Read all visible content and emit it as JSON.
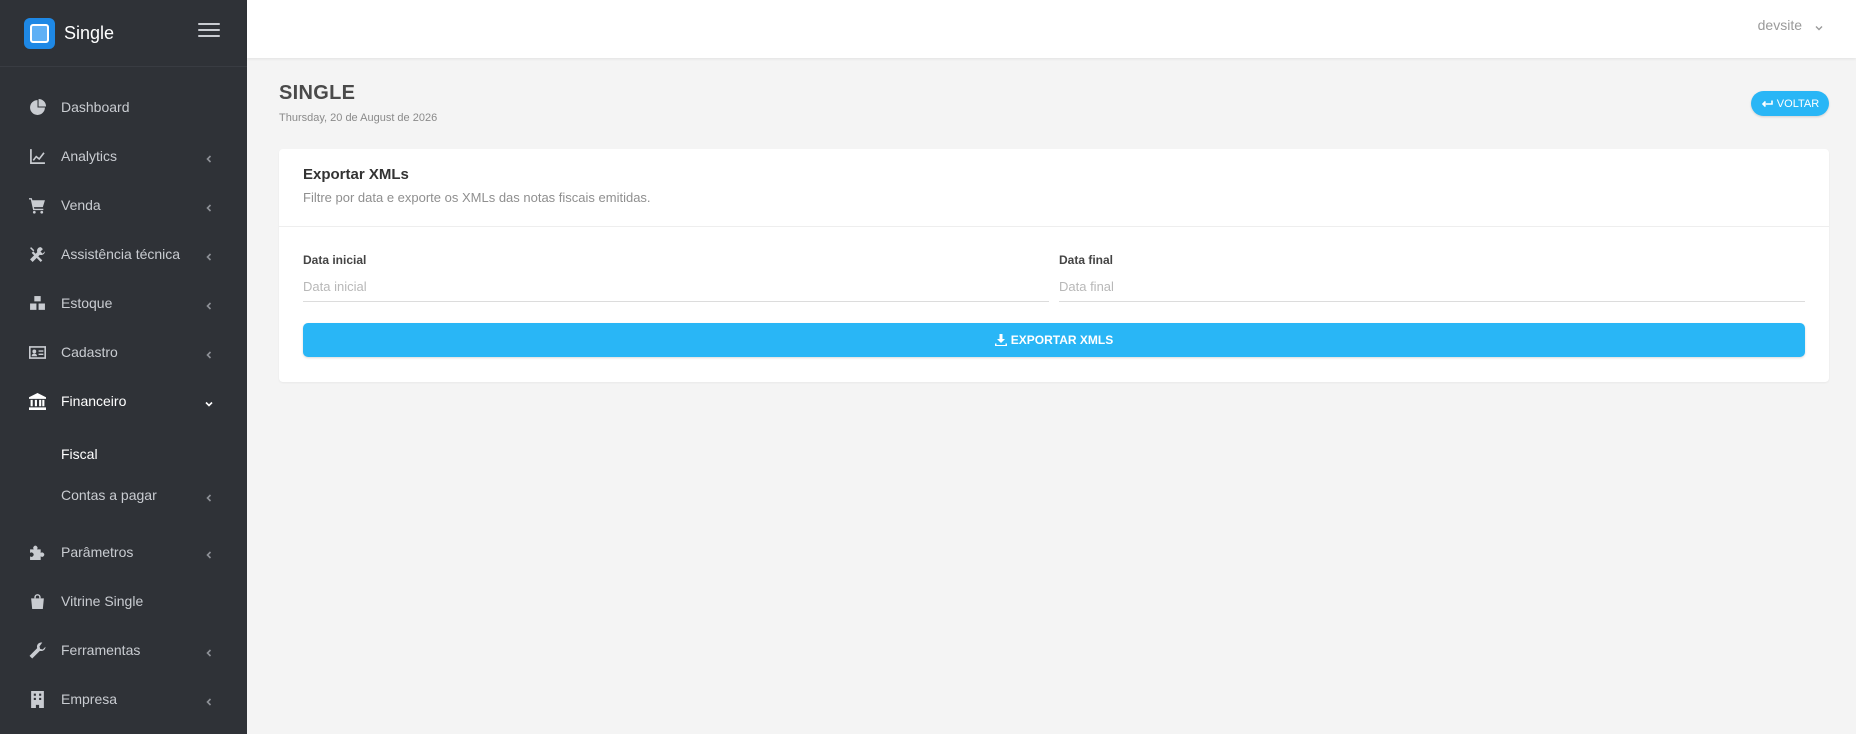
{
  "brand": {
    "name": "Single"
  },
  "sidebar": {
    "items": [
      {
        "label": "Dashboard",
        "icon": "pie-chart-icon",
        "has_submenu": false
      },
      {
        "label": "Analytics",
        "icon": "line-chart-icon",
        "has_submenu": true
      },
      {
        "label": "Venda",
        "icon": "cart-icon",
        "has_submenu": true
      },
      {
        "label": "Assistência técnica",
        "icon": "tools-icon",
        "has_submenu": true
      },
      {
        "label": "Estoque",
        "icon": "boxes-icon",
        "has_submenu": true
      },
      {
        "label": "Cadastro",
        "icon": "id-card-icon",
        "has_submenu": true
      },
      {
        "label": "Financeiro",
        "icon": "bank-icon",
        "has_submenu": true,
        "expanded": true
      },
      {
        "label": "Parâmetros",
        "icon": "puzzle-icon",
        "has_submenu": true
      },
      {
        "label": "Vitrine Single",
        "icon": "shopping-bag-icon",
        "has_submenu": false
      },
      {
        "label": "Ferramentas",
        "icon": "wrench-icon",
        "has_submenu": true
      },
      {
        "label": "Empresa",
        "icon": "building-icon",
        "has_submenu": true
      }
    ],
    "financeiro_submenu": [
      {
        "label": "Fiscal",
        "active": true
      },
      {
        "label": "Contas a pagar",
        "has_submenu": true
      }
    ]
  },
  "topbar": {
    "user_name": "devsite"
  },
  "page": {
    "title": "SINGLE",
    "date": "Thursday, 20 de August de 2026",
    "back_label": "VOLTAR"
  },
  "card": {
    "title": "Exportar XMLs",
    "subtitle": "Filtre por data e exporte os XMLs das notas fiscais emitidas.",
    "start_label": "Data inicial",
    "start_placeholder": "Data inicial",
    "end_label": "Data final",
    "end_placeholder": "Data final",
    "export_label": "EXPORTAR XMLS"
  },
  "colors": {
    "sidebar_bg": "#2f3237",
    "accent": "#29b6f6",
    "page_bg": "#f4f4f4"
  }
}
